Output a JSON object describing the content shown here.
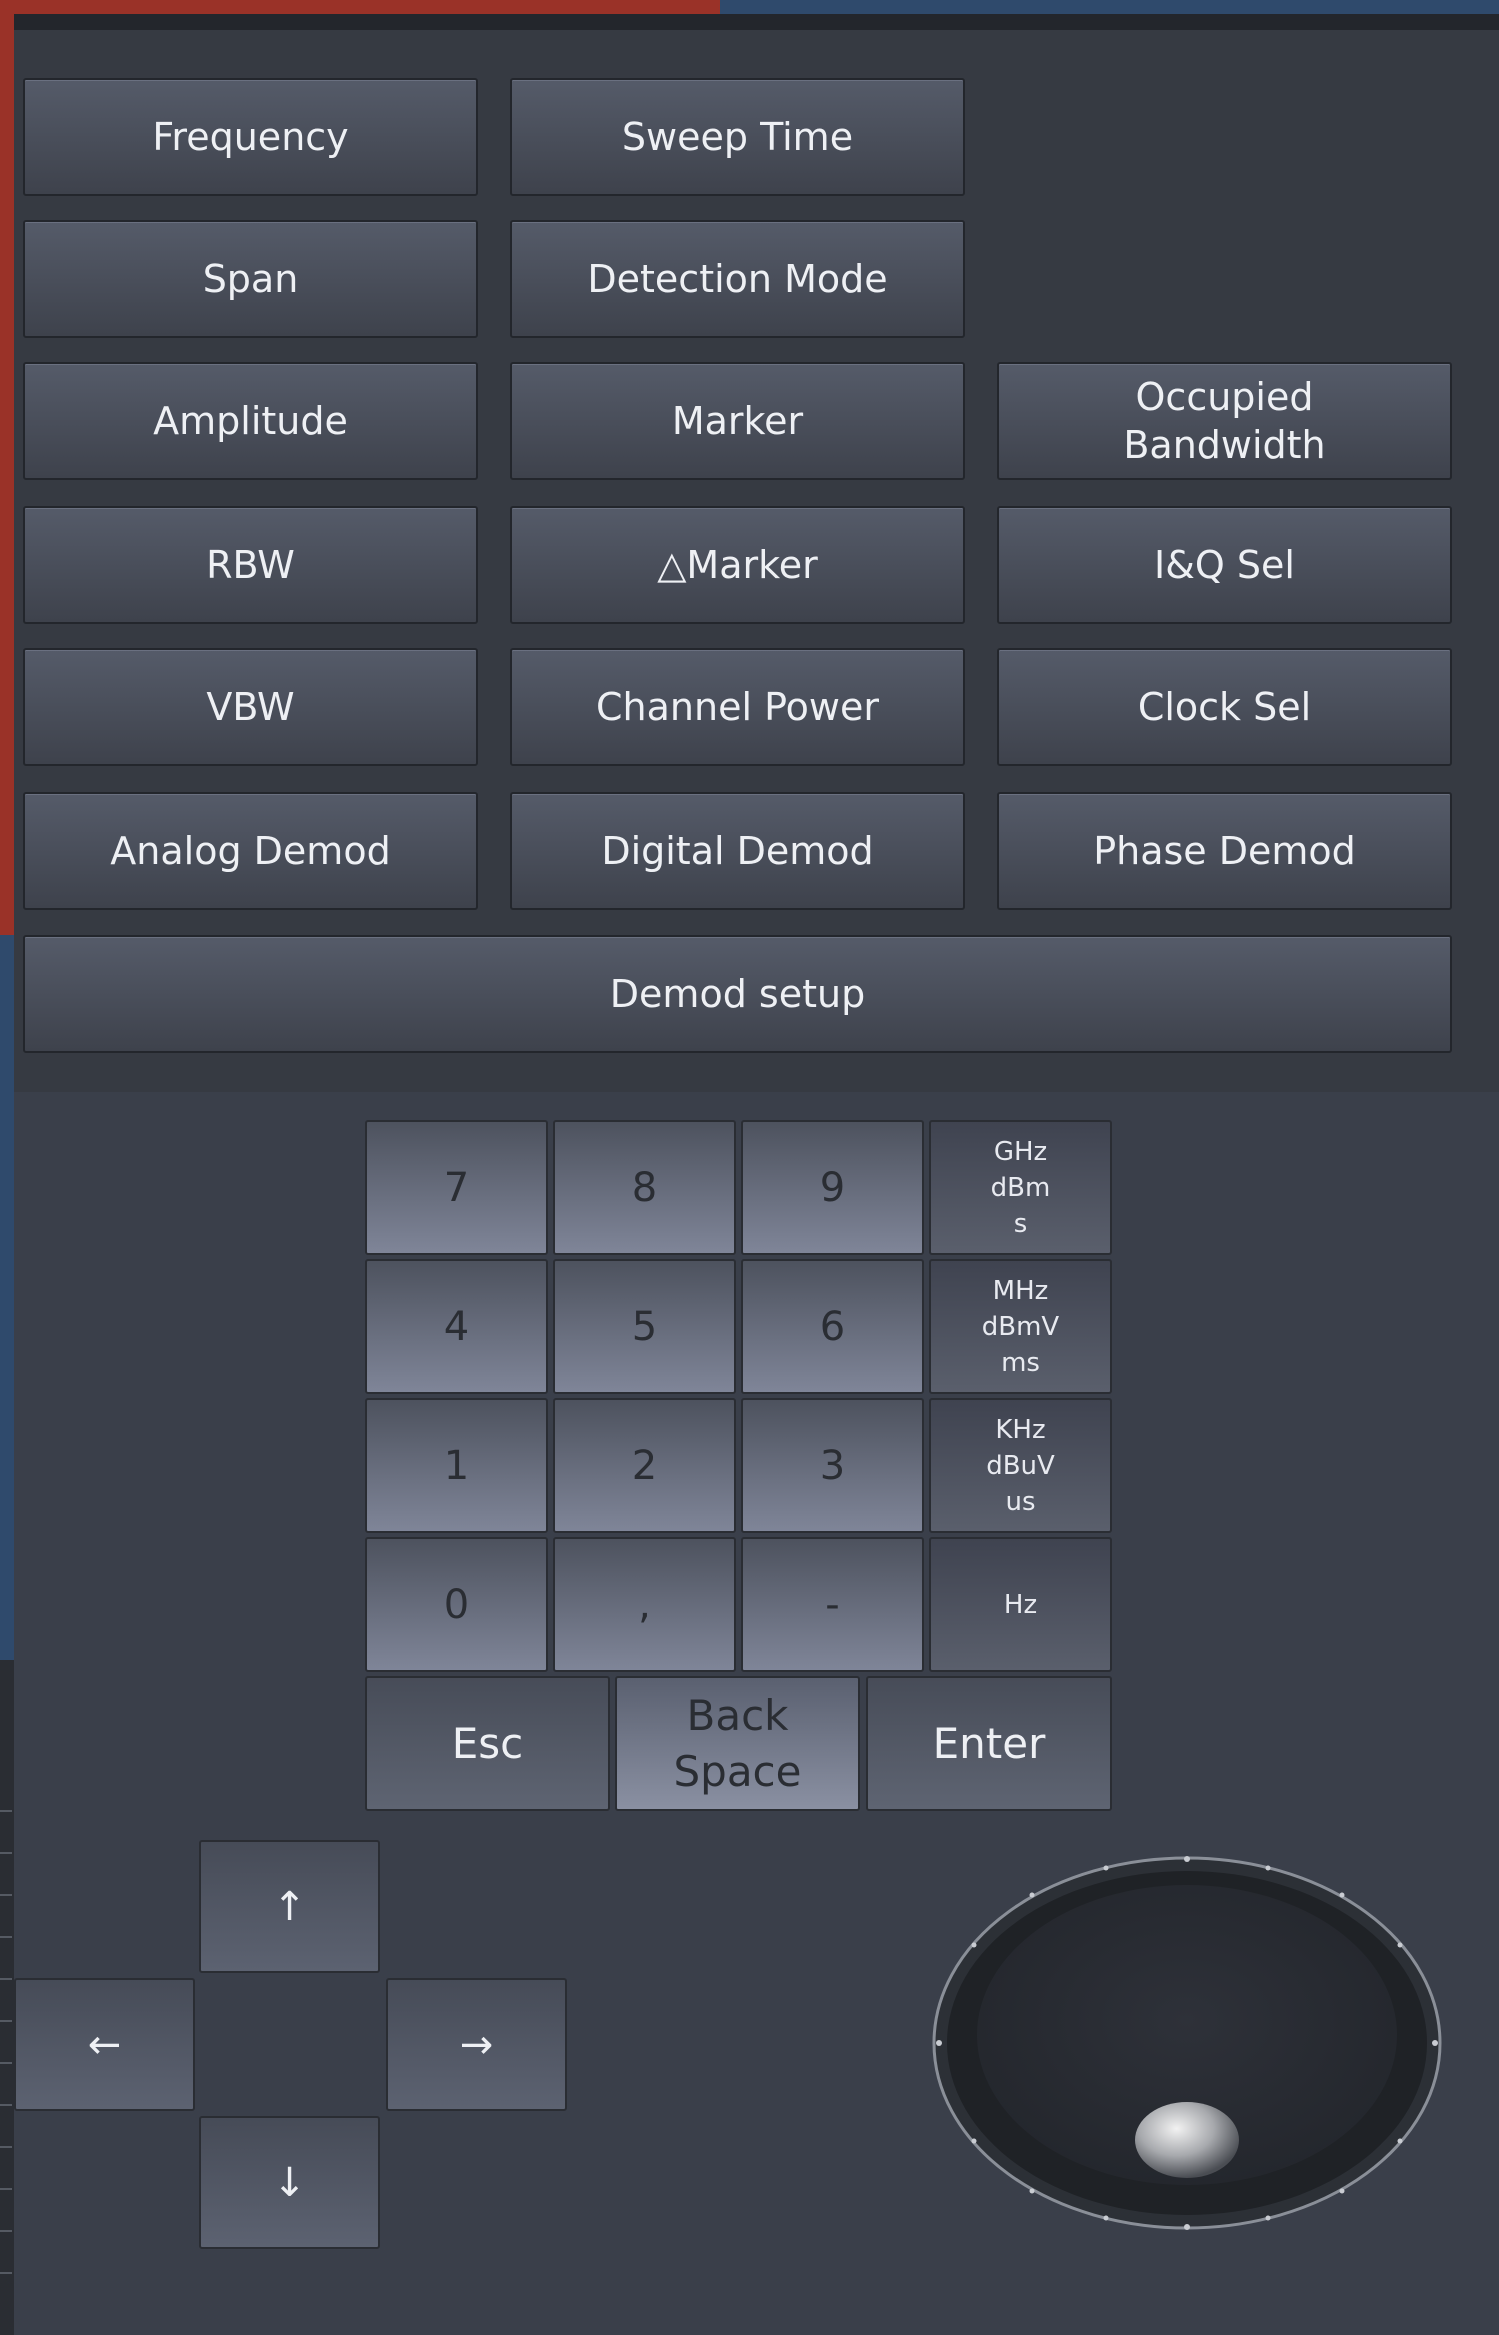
{
  "menu": {
    "buttons": [
      {
        "label": "Frequency"
      },
      {
        "label": "Sweep Time"
      },
      {
        "label": "Span"
      },
      {
        "label": "Detection Mode"
      },
      {
        "label": "Amplitude"
      },
      {
        "label": "Marker"
      },
      {
        "label": "Occupied\nBandwidth"
      },
      {
        "label": "RBW"
      },
      {
        "label": "△Marker"
      },
      {
        "label": "I&Q Sel"
      },
      {
        "label": "VBW"
      },
      {
        "label": "Channel Power"
      },
      {
        "label": "Clock Sel"
      },
      {
        "label": "Analog Demod"
      },
      {
        "label": "Digital Demod"
      },
      {
        "label": "Phase Demod"
      },
      {
        "label": "Demod setup"
      }
    ]
  },
  "keypad": {
    "digits": [
      "7",
      "8",
      "9",
      "4",
      "5",
      "6",
      "1",
      "2",
      "3",
      "0",
      ",",
      "-"
    ],
    "units": [
      "GHz\ndBm\ns",
      "MHz\ndBmV\nms",
      "KHz\ndBuV\nus",
      "Hz"
    ],
    "esc": "Esc",
    "backspace": "Back\nSpace",
    "enter": "Enter"
  },
  "arrows": {
    "up": "↑",
    "left": "←",
    "right": "→",
    "down": "↓"
  },
  "knob": {
    "icon": "rotary-knob-icon"
  }
}
